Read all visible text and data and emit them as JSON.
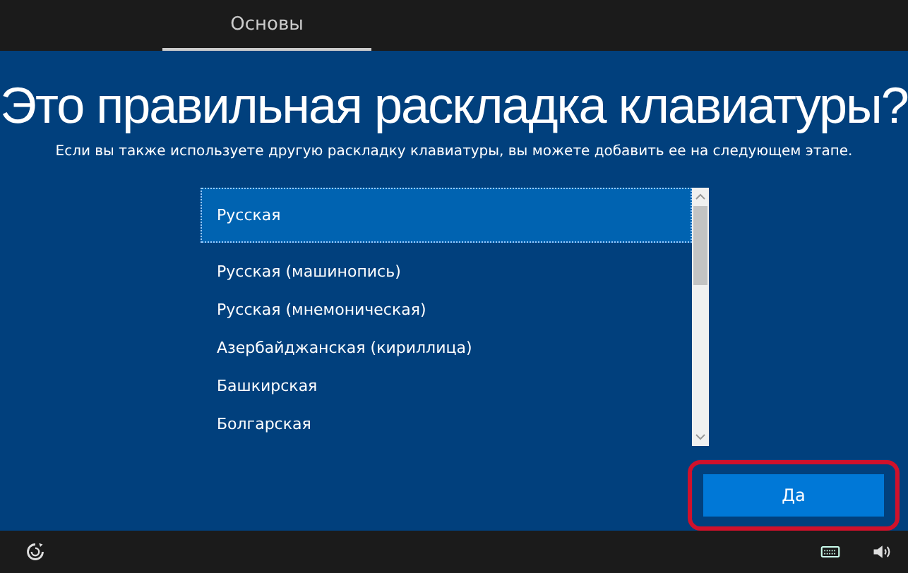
{
  "tabs": [
    {
      "label": "Основы",
      "selected": true
    }
  ],
  "title": "Это правильная раскладка клавиатуры?",
  "subtitle": "Если вы также используете другую раскладку клавиатуры, вы можете добавить ее на следующем этапе.",
  "layouts": [
    {
      "label": "Русская",
      "selected": true
    },
    {
      "label": "Русская (машинопись)",
      "selected": false
    },
    {
      "label": "Русская (мнемоническая)",
      "selected": false
    },
    {
      "label": "Азербайджанская (кириллица)",
      "selected": false
    },
    {
      "label": "Башкирская",
      "selected": false
    },
    {
      "label": "Болгарская",
      "selected": false
    }
  ],
  "button": {
    "label": "Да",
    "highlighted": true
  }
}
